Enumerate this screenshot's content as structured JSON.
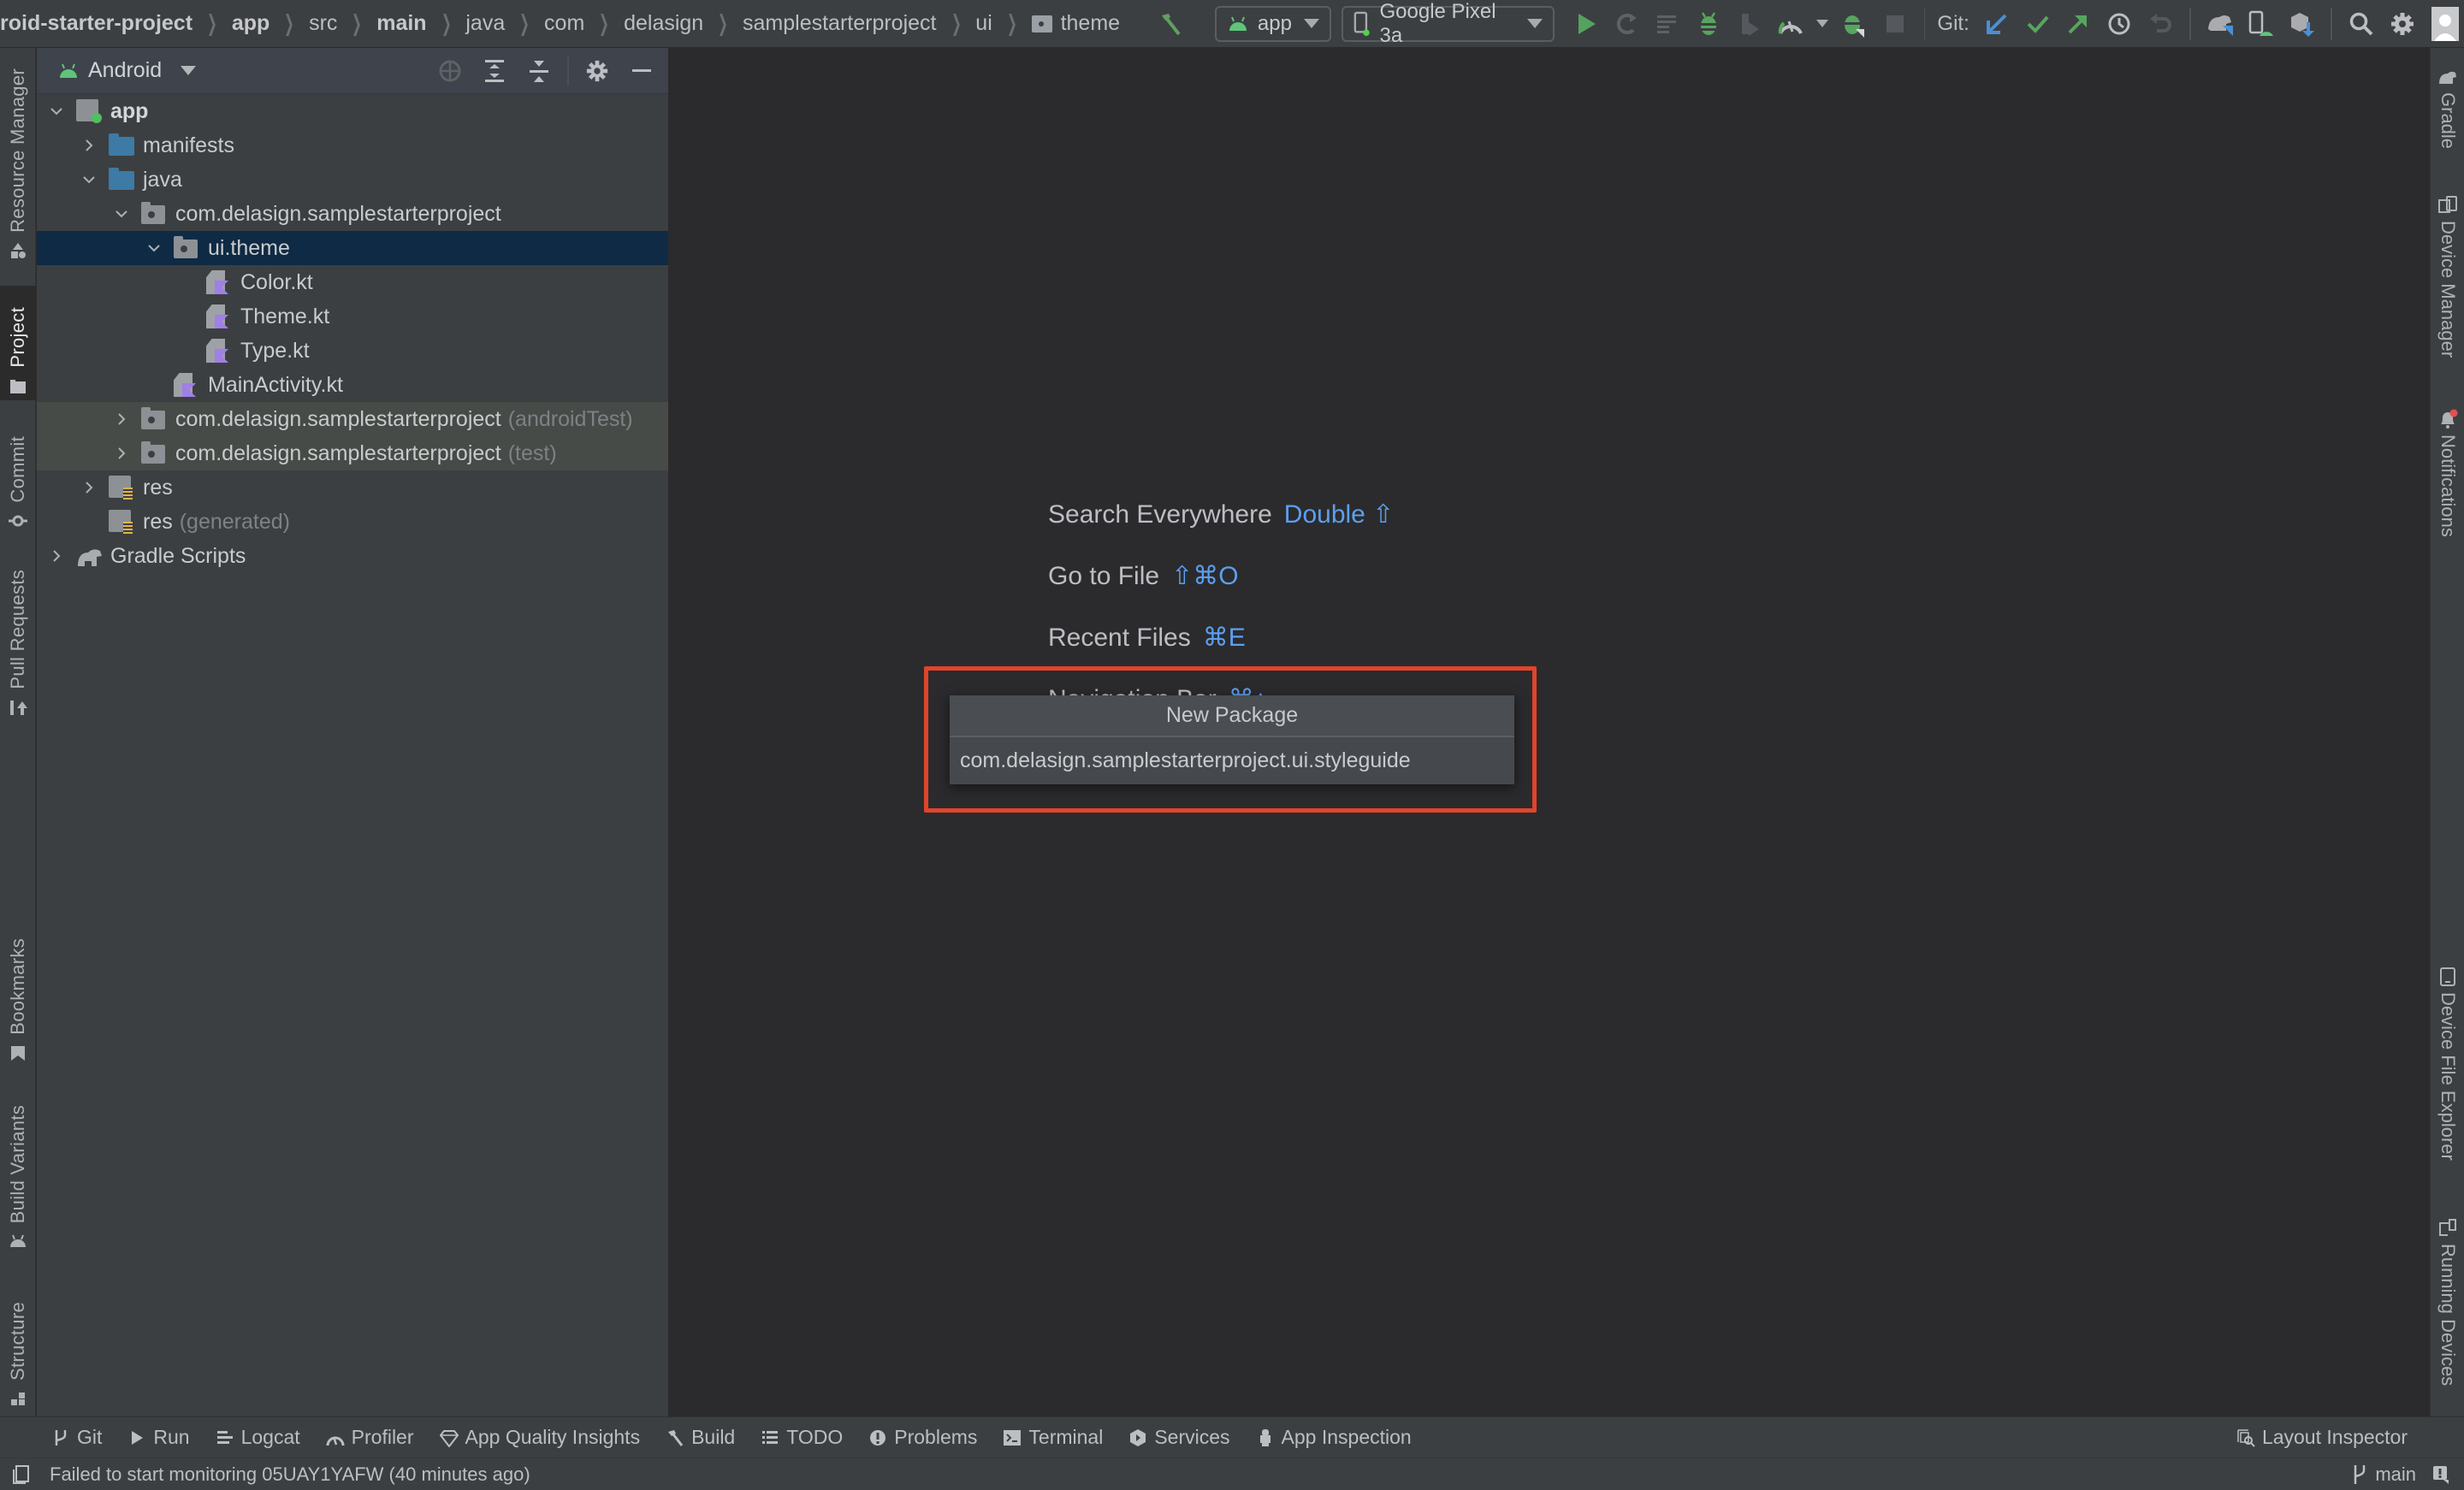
{
  "toolbar": {
    "breadcrumb": [
      "roid-starter-project",
      "app",
      "src",
      "main",
      "java",
      "com",
      "delasign",
      "samplestarterproject",
      "ui",
      "theme"
    ],
    "run_config": "app",
    "device": "Google Pixel 3a",
    "git_label": "Git:",
    "icons": [
      "hammer-icon",
      "run-icon",
      "apply-changes-icon",
      "apply-code-changes-icon",
      "debug-icon",
      "run-with-coverage-icon",
      "profile-icon",
      "attach-debugger-icon",
      "stop-icon",
      "git-update-icon",
      "git-commit-icon",
      "git-push-icon",
      "git-history-icon",
      "git-rollback-icon",
      "sync-gradle-icon",
      "device-manager-icon",
      "sdk-manager-icon",
      "search-icon",
      "settings-icon",
      "avatar"
    ]
  },
  "left_stripe": {
    "tabs": [
      {
        "label": "Resource Manager",
        "icon": "resource-manager-icon"
      },
      {
        "label": "Project",
        "icon": "folder-icon",
        "active": true
      },
      {
        "label": "Commit",
        "icon": "commit-icon"
      },
      {
        "label": "Pull Requests",
        "icon": "pull-request-icon"
      },
      {
        "label": "Bookmarks",
        "icon": "bookmark-icon"
      },
      {
        "label": "Build Variants",
        "icon": "android-icon"
      },
      {
        "label": "Structure",
        "icon": "structure-icon"
      }
    ]
  },
  "right_stripe": {
    "tabs": [
      {
        "label": "Gradle",
        "icon": "gradle-elephant-icon"
      },
      {
        "label": "Device Manager",
        "icon": "device-manager-icon"
      },
      {
        "label": "Notifications",
        "icon": "bell-icon"
      },
      {
        "label": "Device File Explorer",
        "icon": "device-icon"
      },
      {
        "label": "Running Devices",
        "icon": "running-devices-icon"
      }
    ]
  },
  "project_panel": {
    "view": "Android",
    "tree": [
      {
        "label": "app",
        "depth": 0,
        "expanded": true,
        "icon": "app-module",
        "bold": true
      },
      {
        "label": "manifests",
        "depth": 1,
        "expanded": false,
        "icon": "folder-blue"
      },
      {
        "label": "java",
        "depth": 1,
        "expanded": true,
        "icon": "folder-blue"
      },
      {
        "label": "com.delasign.samplestarterproject",
        "depth": 2,
        "expanded": true,
        "icon": "package"
      },
      {
        "label": "ui.theme",
        "depth": 3,
        "expanded": true,
        "icon": "package",
        "selected": true
      },
      {
        "label": "Color.kt",
        "depth": 4,
        "icon": "kotlin-file"
      },
      {
        "label": "Theme.kt",
        "depth": 4,
        "icon": "kotlin-file"
      },
      {
        "label": "Type.kt",
        "depth": 4,
        "icon": "kotlin-file"
      },
      {
        "label": "MainActivity.kt",
        "depth": 3,
        "icon": "kotlin-file"
      },
      {
        "label": "com.delasign.samplestarterproject",
        "suffix": "(androidTest)",
        "depth": 2,
        "expanded": false,
        "icon": "package",
        "test": true
      },
      {
        "label": "com.delasign.samplestarterproject",
        "suffix": "(test)",
        "depth": 2,
        "expanded": false,
        "icon": "package",
        "test": true
      },
      {
        "label": "res",
        "depth": 1,
        "expanded": false,
        "icon": "res-folder"
      },
      {
        "label": "res",
        "suffix": "(generated)",
        "depth": 1,
        "icon": "res-folder"
      },
      {
        "label": "Gradle Scripts",
        "depth": 0,
        "expanded": false,
        "icon": "gradle"
      }
    ]
  },
  "editor": {
    "hints": [
      {
        "label": "Search Everywhere",
        "shortcut": "Double ⇧"
      },
      {
        "label": "Go to File",
        "shortcut": "⇧⌘O"
      },
      {
        "label": "Recent Files",
        "shortcut": "⌘E"
      },
      {
        "label": "Navigation Bar",
        "shortcut": "⌘↑"
      }
    ]
  },
  "new_package_dialog": {
    "title": "New Package",
    "value": "com.delasign.samplestarterproject.ui.styleguide",
    "highlight_color": "#e0442c"
  },
  "bottom_bar": {
    "tools": [
      {
        "label": "Git",
        "icon": "git-branch-icon"
      },
      {
        "label": "Run",
        "icon": "run-icon"
      },
      {
        "label": "Logcat",
        "icon": "logcat-icon"
      },
      {
        "label": "Profiler",
        "icon": "profiler-icon"
      },
      {
        "label": "App Quality Insights",
        "icon": "diamond-icon"
      },
      {
        "label": "Build",
        "icon": "hammer-icon"
      },
      {
        "label": "TODO",
        "icon": "list-icon"
      },
      {
        "label": "Problems",
        "icon": "problems-icon"
      },
      {
        "label": "Terminal",
        "icon": "terminal-icon"
      },
      {
        "label": "Services",
        "icon": "services-icon"
      },
      {
        "label": "App Inspection",
        "icon": "app-inspection-icon"
      }
    ],
    "right_tool": {
      "label": "Layout Inspector",
      "icon": "layout-inspector-icon"
    }
  },
  "status_bar": {
    "message": "Failed to start monitoring 05UAY1YAFW (40 minutes ago)",
    "branch": "main"
  }
}
